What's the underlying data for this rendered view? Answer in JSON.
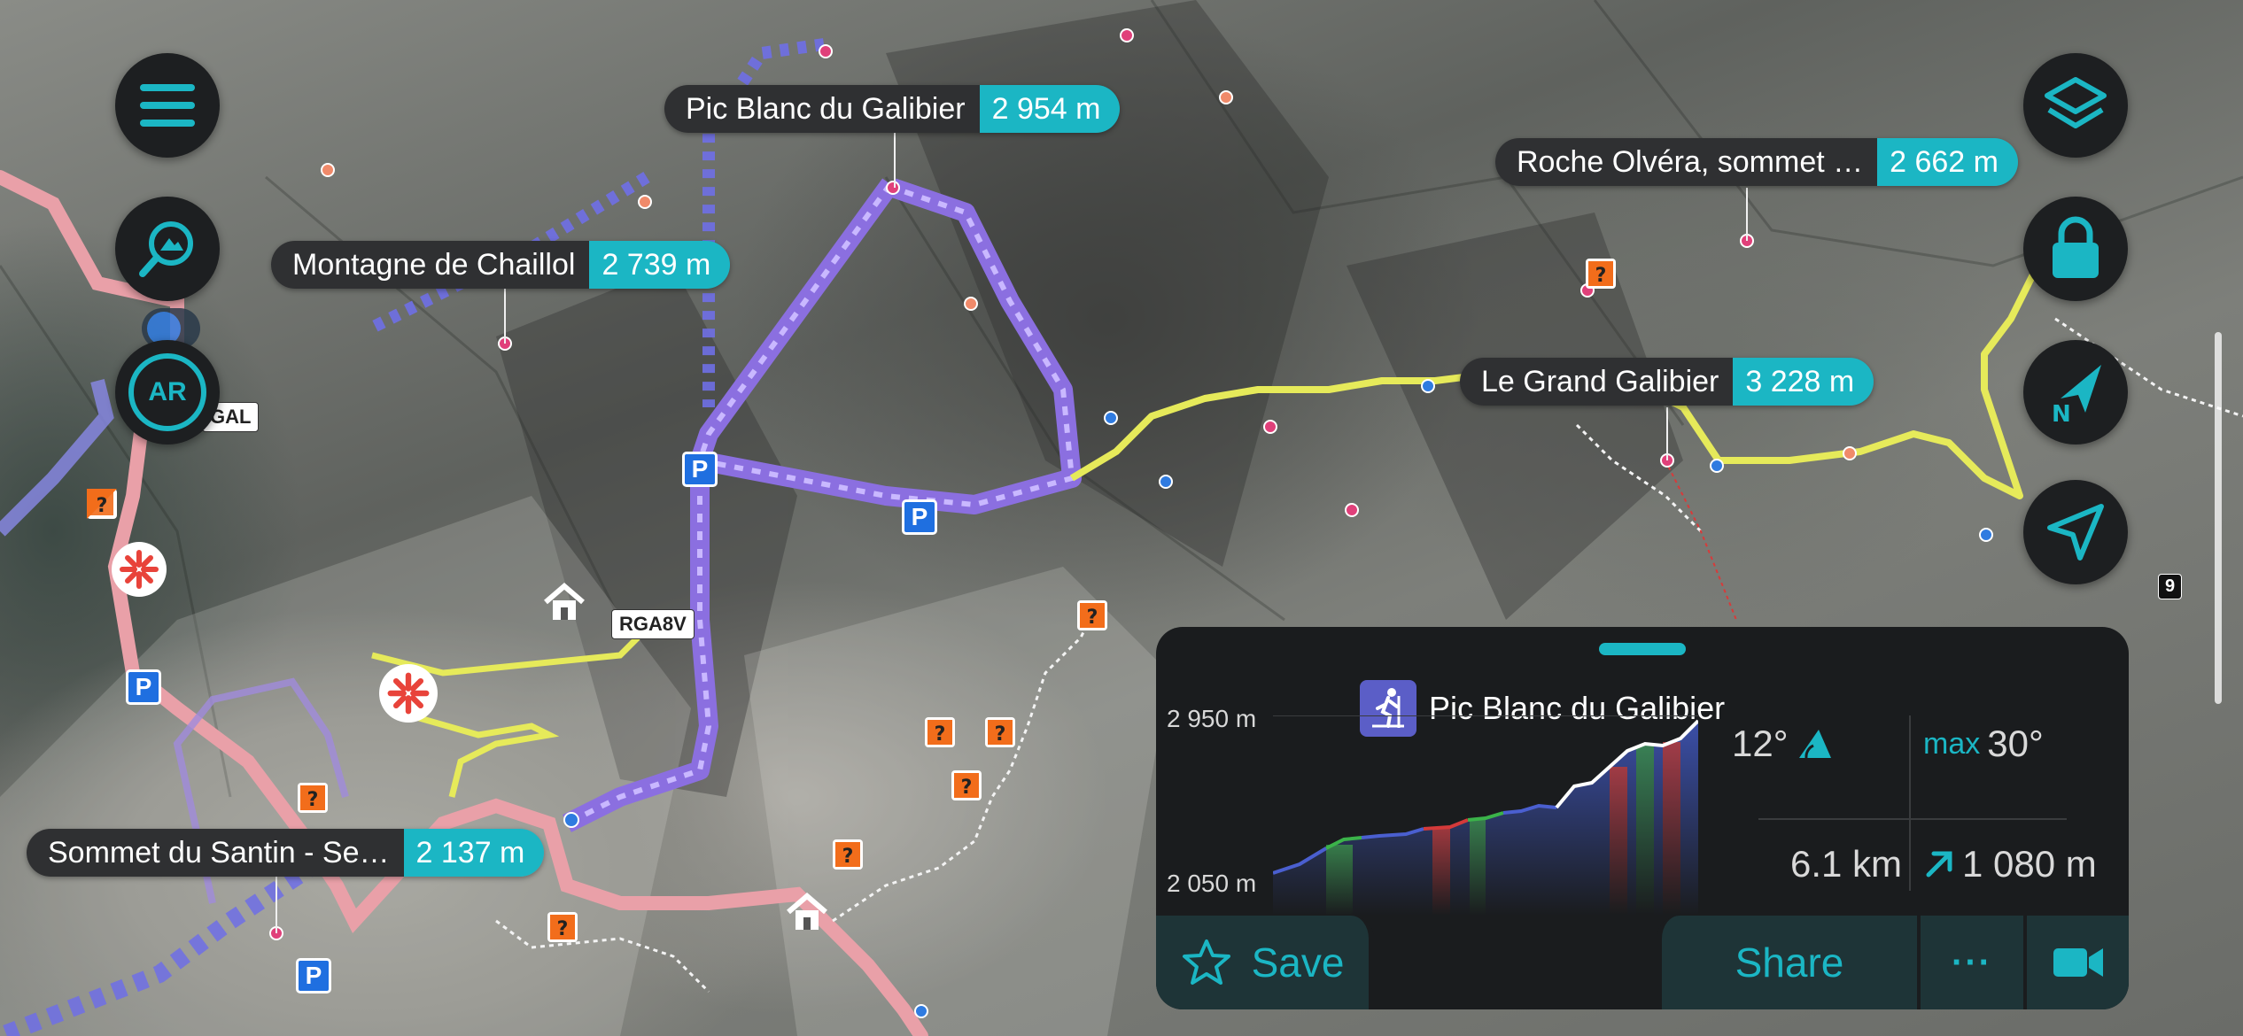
{
  "map_labels": {
    "pic_blanc": {
      "name": "Pic Blanc du Galibier",
      "elevation": "2 954 m"
    },
    "roche_olvera": {
      "name": "Roche Olvéra, sommet …",
      "elevation": "2 662 m"
    },
    "montagne_chaillol": {
      "name": "Montagne de Chaillol",
      "elevation": "2 739 m"
    },
    "grand_galibier": {
      "name": "Le Grand Galibier",
      "elevation": "3 228 m"
    },
    "sommet_santin": {
      "name": "Sommet du Santin - Se…",
      "elevation": "2 137 m"
    }
  },
  "map_badges": {
    "gal": "GAL",
    "rga8v": "RGA8V",
    "nine": "9"
  },
  "map_markers": {
    "parking": "P"
  },
  "left_controls": {
    "ar": "AR"
  },
  "icons": {
    "menu": "hamburger-menu-icon",
    "search": "map-search-icon",
    "layers": "layers-icon",
    "lock": "lock-icon",
    "compass": "north-compass-icon",
    "location": "location-arrow-icon",
    "activity": "ski-touring-icon",
    "slope": "slope-icon",
    "ascent": "ascent-arrow-icon",
    "star": "star-icon",
    "video": "video-camera-icon"
  },
  "panel": {
    "title": "Pic Blanc du Galibier",
    "y_top": "2 950 m",
    "y_bottom": "2 050 m",
    "avg_slope": "12°",
    "max_label": "max",
    "max_slope": "30°",
    "distance": "6.1 km",
    "ascent": "1 080 m",
    "save_label": "Save",
    "share_label": "Share",
    "more_label": "···"
  },
  "colors": {
    "accent": "#1bb6c4",
    "panel_bg": "#1a1c1e",
    "route_purple": "#8b6fe0",
    "trail_yellow": "#e6ea5a",
    "road_pink": "#e9a0a8"
  }
}
